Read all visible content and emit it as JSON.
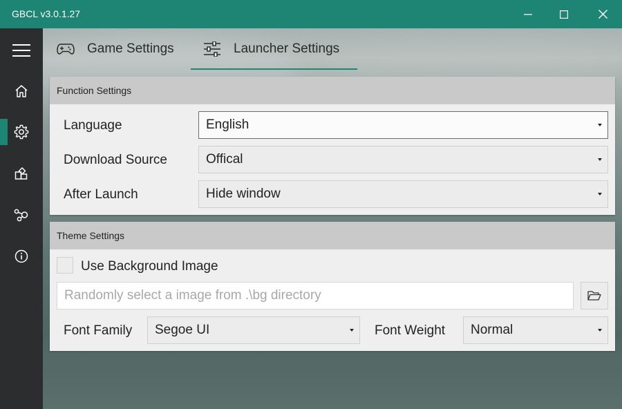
{
  "window": {
    "title": "GBCL v3.0.1.27"
  },
  "sidebar": {
    "items": [
      {
        "icon": "menu-icon"
      },
      {
        "icon": "home-icon"
      },
      {
        "icon": "gear-icon",
        "active": true
      },
      {
        "icon": "puzzle-icon"
      },
      {
        "icon": "share-icon"
      },
      {
        "icon": "info-icon"
      }
    ]
  },
  "tabs": {
    "game_settings": "Game Settings",
    "launcher_settings": "Launcher Settings"
  },
  "function_settings": {
    "header": "Function Settings",
    "language_label": "Language",
    "language_value": "English",
    "download_source_label": "Download Source",
    "download_source_value": "Offical",
    "after_launch_label": "After Launch",
    "after_launch_value": "Hide window"
  },
  "theme_settings": {
    "header": "Theme Settings",
    "use_bg_label": "Use Background Image",
    "bg_path_placeholder": "Randomly select a image from .\\bg directory",
    "font_family_label": "Font Family",
    "font_family_value": "Segoe UI",
    "font_weight_label": "Font Weight",
    "font_weight_value": "Normal"
  },
  "colors": {
    "accent": "#1e8473",
    "sidebar": "#2b2d2e",
    "card": "#efefef",
    "card_header": "#c9c9c9"
  }
}
